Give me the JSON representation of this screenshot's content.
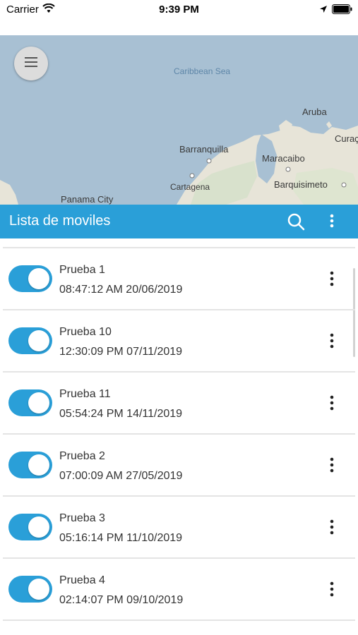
{
  "status_bar": {
    "carrier": "Carrier",
    "time": "9:39 PM",
    "icons": [
      "wifi-icon",
      "location-icon",
      "battery-icon"
    ]
  },
  "map": {
    "labels": {
      "caribbean_sea": "Caribbean Sea",
      "aruba": "Aruba",
      "curacao": "Curaç",
      "barranquilla": "Barranquilla",
      "maracaibo": "Maracaibo",
      "cartagena": "Cartagena",
      "barquisimeto": "Barquisimeto",
      "panama_city": "Panama City"
    },
    "menu_icon": "hamburger-menu-icon"
  },
  "toolbar": {
    "title": "Lista de moviles",
    "search_icon": "search-icon",
    "overflow_icon": "more-vert-icon"
  },
  "colors": {
    "accent": "#2a9fd8",
    "map_water": "#a8c0d3",
    "map_land": "#e7e4d8"
  },
  "devices": [
    {
      "name": "Prueba 1",
      "timestamp": "08:47:12 AM 20/06/2019",
      "enabled": true
    },
    {
      "name": "Prueba 10",
      "timestamp": "12:30:09 PM 07/11/2019",
      "enabled": true
    },
    {
      "name": "Prueba 11",
      "timestamp": "05:54:24 PM 14/11/2019",
      "enabled": true
    },
    {
      "name": "Prueba 2",
      "timestamp": "07:00:09 AM 27/05/2019",
      "enabled": true
    },
    {
      "name": "Prueba 3",
      "timestamp": "05:16:14 PM 11/10/2019",
      "enabled": true
    },
    {
      "name": "Prueba 4",
      "timestamp": "02:14:07 PM 09/10/2019",
      "enabled": true
    }
  ]
}
